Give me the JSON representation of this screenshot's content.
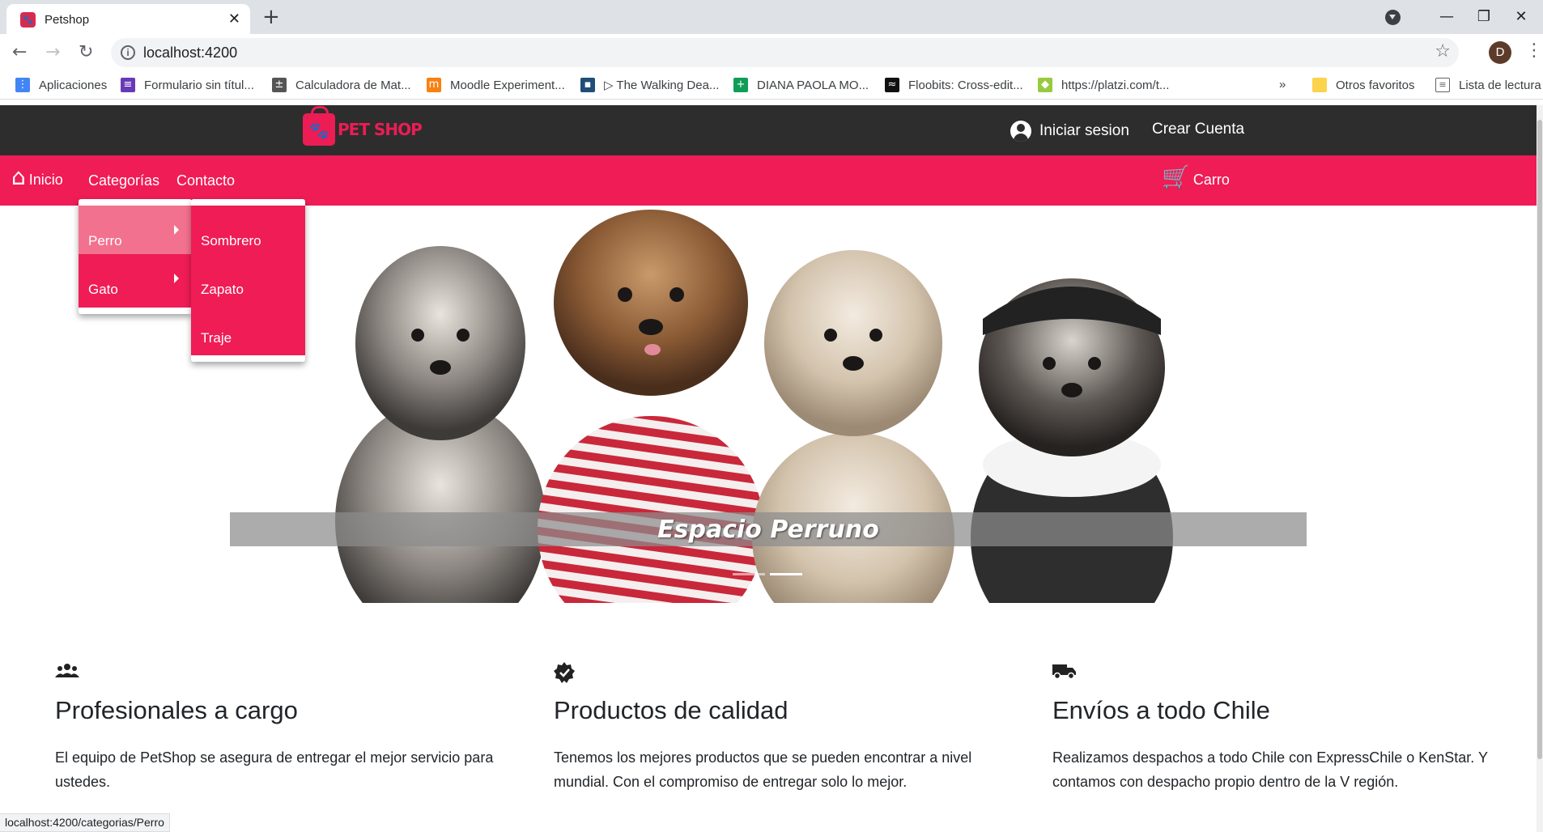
{
  "browser": {
    "tab_title": "Petshop",
    "tab_close": "✕",
    "new_tab": "+",
    "url": "localhost:4200",
    "window_controls": {
      "minimize": "—",
      "restore": "❐",
      "close": "✕"
    },
    "bookmarks": [
      {
        "label": "Aplicaciones",
        "icon": "apps-grid-icon",
        "color": "#4285f4"
      },
      {
        "label": "Formulario sin títul...",
        "icon": "forms-icon",
        "color": "#673ab7"
      },
      {
        "label": "Calculadora de Mat...",
        "icon": "calculator-icon",
        "color": "#555555"
      },
      {
        "label": "Moodle Experiment...",
        "icon": "moodle-icon",
        "color": "#f98012"
      },
      {
        "label": "▷ The Walking Dea...",
        "icon": "video-icon",
        "color": "#1f4e79"
      },
      {
        "label": "DIANA PAOLA MO...",
        "icon": "sheets-icon",
        "color": "#0f9d58"
      },
      {
        "label": "Floobits: Cross-edit...",
        "icon": "floobits-icon",
        "color": "#111111"
      },
      {
        "label": "https://platzi.com/t...",
        "icon": "platzi-icon",
        "color": "#98ca3f"
      }
    ],
    "bookmarks_overflow": "»",
    "other_favorites": "Otros favoritos",
    "reading_list": "Lista de lectura",
    "avatar_letter": "D",
    "status_url": "localhost:4200/categorias/Perro"
  },
  "header": {
    "logo_text": "PET SHOP",
    "login_label": "Iniciar sesion",
    "register_label": "Crear Cuenta"
  },
  "nav": {
    "home": "Inicio",
    "categories": "Categorías",
    "contact": "Contacto",
    "cart": "Carro"
  },
  "categories_menu": [
    {
      "label": "Perro",
      "active": true
    },
    {
      "label": "Gato",
      "active": false
    }
  ],
  "subcategory_menu": [
    {
      "label": "Sombrero"
    },
    {
      "label": "Zapato"
    },
    {
      "label": "Traje"
    }
  ],
  "hero": {
    "caption": "Espacio Perruno",
    "slides": 2,
    "active_slide": 2
  },
  "features": [
    {
      "icon": "people-icon",
      "title": "Profesionales a cargo",
      "text": "El equipo de PetShop se asegura de entregar el mejor servicio para ustedes."
    },
    {
      "icon": "verified-badge-icon",
      "title": "Productos de calidad",
      "text": "Tenemos los mejores productos que se pueden encontrar a nivel mundial. Con el compromiso de entregar solo lo mejor."
    },
    {
      "icon": "truck-icon",
      "title": "Envíos a todo Chile",
      "text": "Realizamos despachos a todo Chile con ExpressChile o KenStar. Y contamos con despacho propio dentro de la V región."
    }
  ],
  "colors": {
    "brand_pink": "#ef1c56",
    "header_dark": "#2d2d2d",
    "menu_active": "#f2718f"
  }
}
